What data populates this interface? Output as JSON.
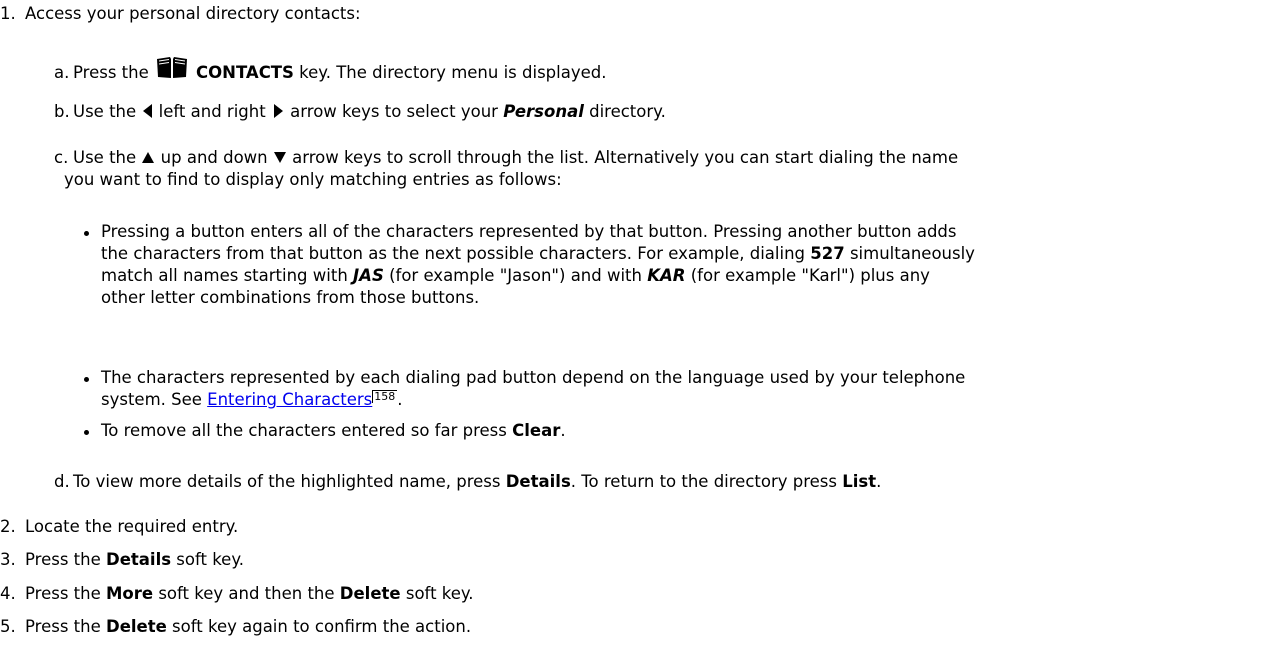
{
  "steps": [
    {
      "num": "1.",
      "text": "Access your personal directory contacts:"
    },
    {
      "num": "2.",
      "text": "Locate the required entry."
    },
    {
      "num": "3.",
      "pre": "Press the ",
      "bold": "Details",
      "post": " soft key."
    },
    {
      "num": "4.",
      "pre": "Press the ",
      "bold": "More",
      "mid": " soft key and then the ",
      "bold2": "Delete",
      "post": " soft key."
    },
    {
      "num": "5.",
      "pre": "Press the ",
      "bold": "Delete",
      "post": " soft key again to confirm the action."
    }
  ],
  "substeps": {
    "a": {
      "num": "a.",
      "pre": "Press the ",
      "bold": "CONTACTS",
      "post": " key. The directory menu is displayed.",
      "icon": "book-icon"
    },
    "b": {
      "num": "b.",
      "pre": "Use the ",
      "mid": " left and right ",
      "mid2": " arrow keys to select your ",
      "bold": "Personal",
      "post": " directory.",
      "icons": [
        "left-arrow-icon",
        "right-arrow-icon"
      ]
    },
    "c": {
      "num": "c.",
      "pre": "Use the ",
      "mid": " up and down ",
      "post": " arrow keys to scroll through the list. Alternatively you can start dialing the name",
      "line2": "you want to find to display only matching entries as follows:",
      "icons": [
        "up-arrow-icon",
        "down-arrow-icon"
      ]
    },
    "d": {
      "num": "d.",
      "pre": "To view more details of the highlighted name, press ",
      "bold": "Details",
      "mid": ". To return to the directory press ",
      "bold2": "List",
      "post": "."
    }
  },
  "bullets": {
    "b1": {
      "l1": "Pressing a button enters all of the characters represented by that button. Pressing another button adds",
      "l2_pre": "the characters from that button as the next possible characters. For example, dialing ",
      "l2_bold": "527",
      "l2_post": " simultaneously",
      "l3_pre": "match all names starting with ",
      "l3_bi": "JAS",
      "l3_mid": " (for example \"Jason\") and with ",
      "l3_bi2": "KAR",
      "l3_post": " (for example \"Karl\") plus any",
      "l4": "other letter combinations from those buttons."
    },
    "b2": {
      "l1": "The characters represented by each dialing pad button depend on the language used by your telephone",
      "l2_pre": "system. See ",
      "link": "Entering Characters",
      "xref": "158",
      "l2_post": "."
    },
    "b3": {
      "pre": "To remove all the characters entered so far press ",
      "bold": "Clear",
      "post": "."
    }
  }
}
